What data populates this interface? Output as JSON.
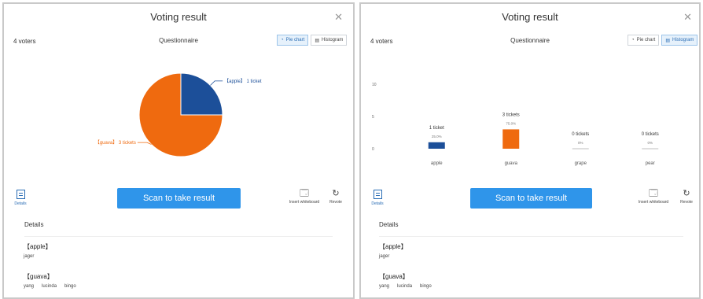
{
  "colors": {
    "blue": "#1c4f99",
    "orange": "#ef6a0f",
    "accent": "#2f95ea"
  },
  "left_panel": {
    "title": "Voting result",
    "close_icon": "close-icon",
    "voters": "4 voters",
    "subtitle": "Questionnaire",
    "toggle": {
      "pie_label": "Pie chart",
      "histogram_label": "Histogram",
      "selected": "Pie chart"
    },
    "details_label": "Details",
    "scan_label": "Scan to take result",
    "insert_label": "Insert whiteboard",
    "revote_label": "Revote",
    "details_header": "Details",
    "options": [
      {
        "label": "【apple】",
        "names": [
          "jager"
        ]
      },
      {
        "label": "【guava】",
        "names": [
          "yang",
          "lucinda",
          "bingo"
        ]
      }
    ]
  },
  "right_panel": {
    "title": "Voting result",
    "close_icon": "close-icon",
    "voters": "4 voters",
    "subtitle": "Questionnaire",
    "toggle": {
      "pie_label": "Pie chart",
      "histogram_label": "Histogram",
      "selected": "Histogram"
    },
    "details_label": "Details",
    "scan_label": "Scan to take result",
    "insert_label": "Insert whiteboard",
    "revote_label": "Revote",
    "details_header": "Details",
    "options": [
      {
        "label": "【apple】",
        "names": [
          "jager"
        ]
      },
      {
        "label": "【guava】",
        "names": [
          "yang",
          "lucinda",
          "bingo"
        ]
      }
    ]
  },
  "chart_data": [
    {
      "type": "pie",
      "slices": [
        {
          "name": "apple",
          "value": 1,
          "label": "【apple】 1 ticket",
          "color": "#1c4f99"
        },
        {
          "name": "guava",
          "value": 3,
          "label": "【guava】 3 tickets",
          "color": "#ef6a0f"
        }
      ],
      "legend": "none"
    },
    {
      "type": "bar",
      "categories": [
        "apple",
        "guava",
        "grape",
        "pear"
      ],
      "values": [
        1,
        3,
        0,
        0
      ],
      "data_labels": [
        "1 ticket",
        "3 tickets",
        "0 tickets",
        "0 tickets"
      ],
      "percent_labels": [
        "25.0%",
        "75.0%",
        "0%",
        "0%"
      ],
      "yticks": [
        "10",
        "5",
        "0"
      ],
      "ylim": [
        0,
        10
      ],
      "colors": [
        "#1c4f99",
        "#ef6a0f",
        "#ef6a0f",
        "#ef6a0f"
      ],
      "grid": false
    }
  ]
}
